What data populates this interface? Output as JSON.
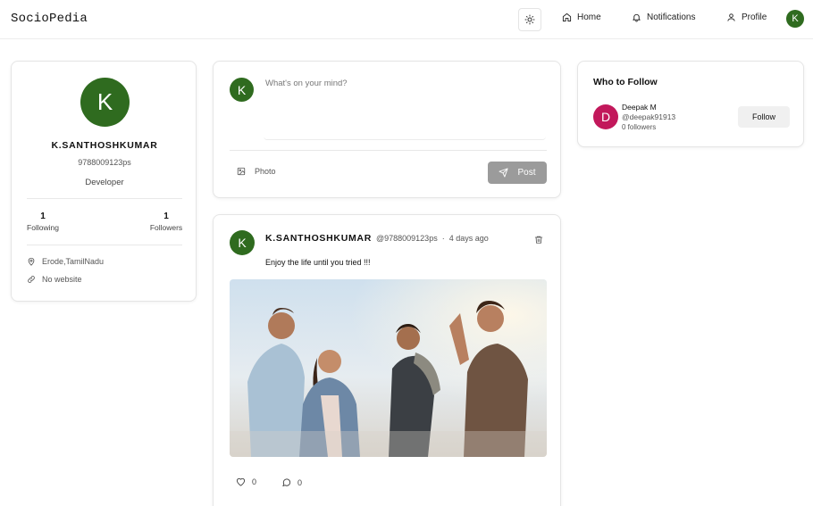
{
  "brand": "SocioPedia",
  "nav": {
    "home": "Home",
    "notifications": "Notifications",
    "profile": "Profile",
    "avatar_initial": "K"
  },
  "profile": {
    "avatar_initial": "K",
    "name": "K.SANTHOSHKUMAR",
    "handle": "9788009123ps",
    "role": "Developer",
    "following_count": "1",
    "following_label": "Following",
    "followers_count": "1",
    "followers_label": "Followers",
    "location": "Erode,TamilNadu",
    "website": "No website"
  },
  "composer": {
    "avatar_initial": "K",
    "placeholder": "What's on your mind?",
    "photo_label": "Photo",
    "post_label": "Post"
  },
  "post": {
    "avatar_initial": "K",
    "author": "K.SANTHOSHKUMAR",
    "handle": "@9788009123ps",
    "separator": "·",
    "time": "4 days ago",
    "text": "Enjoy the life until you tried !!!",
    "likes": "0",
    "comments": "0"
  },
  "who_to_follow": {
    "title": "Who to Follow",
    "suggestions": [
      {
        "initial": "D",
        "name": "Deepak M",
        "handle": "@deepak91913",
        "followers": "0 followers",
        "button": "Follow",
        "avatar_color": "#c2185b"
      }
    ]
  },
  "colors": {
    "avatar_green": "#2f6b1f",
    "post_button_gray": "#9b9b9b"
  }
}
